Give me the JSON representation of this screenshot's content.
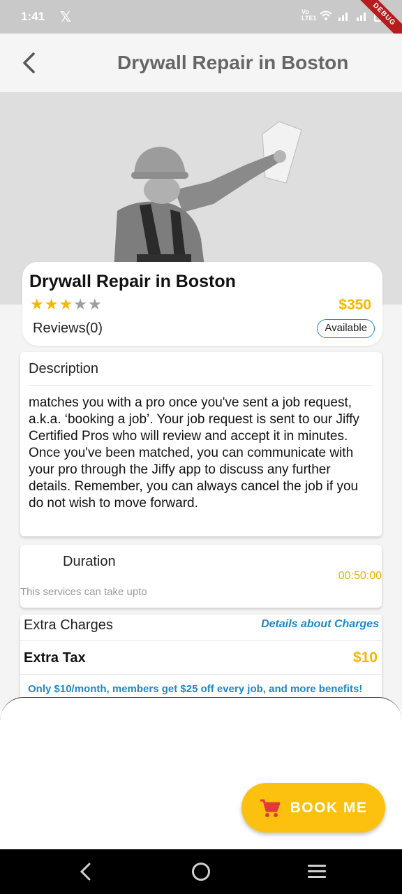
{
  "status_bar": {
    "time": "1:41",
    "app_icon": "x-logo-icon",
    "network_label": "Vo LTE1",
    "debug_label": "DEBUG"
  },
  "app_bar": {
    "title": "Drywall Repair in Boston",
    "back_icon": "chevron-left-icon"
  },
  "hero": {
    "image_description": "worker-plastering-wall-image"
  },
  "service": {
    "name": "Drywall Repair in Boston",
    "rating": 3,
    "rating_max": 5,
    "price": "$350",
    "reviews_label": "Reviews(0)",
    "availability": "Available"
  },
  "description": {
    "heading": "Description",
    "body": "matches you with a pro once you've sent a job request, a.k.a. ‘booking a job’. Your job request is sent to our Jiffy Certified Pros who will review and accept it in minutes. Once you've been matched, you can communicate with your pro through the Jiffy app to discuss any further details. Remember, you can always cancel the job if you do not wish to move forward."
  },
  "duration": {
    "label": "Duration",
    "value": "00:50:00",
    "note": "This services can take upto"
  },
  "charges": {
    "title": "Extra Charges",
    "details_link": "Details about Charges",
    "tax_label": "Extra Tax",
    "tax_amount": "$10",
    "promo": "Only $10/month, members get $25 off every job, and more benefits!"
  },
  "actions": {
    "book_label": "BOOK ME",
    "book_icon": "cart-icon"
  },
  "colors": {
    "accent_yellow": "#fcc10f",
    "price_yellow": "#f5b800",
    "link_blue": "#1e88c7"
  }
}
